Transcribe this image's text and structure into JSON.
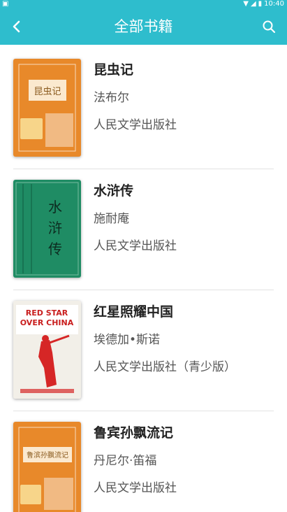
{
  "status_bar": {
    "time": "10:40"
  },
  "header": {
    "title": "全部书籍",
    "back_icon": "chevron-left-icon",
    "search_icon": "search-icon"
  },
  "books": [
    {
      "title": "昆虫记",
      "author": "法布尔",
      "publisher": "人民文学出版社",
      "cover_text": "昆虫记",
      "cover_color": "#e8892a"
    },
    {
      "title": "水浒传",
      "author": "施耐庵",
      "publisher": "人民文学出版社",
      "cover_text": "水浒传",
      "cover_color": "#1f8c64"
    },
    {
      "title": "红星照耀中国",
      "author": "埃德加•斯诺",
      "publisher": "人民文学出版社（青少版）",
      "cover_text": "RED STAR OVER CHINA",
      "cover_color": "#f2efe8"
    },
    {
      "title": "鲁宾孙飘流记",
      "author": "丹尼尔·笛福",
      "publisher": "人民文学出版社",
      "cover_text": "鲁滨孙飘流记",
      "cover_color": "#e8892a"
    }
  ],
  "colors": {
    "accent": "#2ebdcd"
  }
}
